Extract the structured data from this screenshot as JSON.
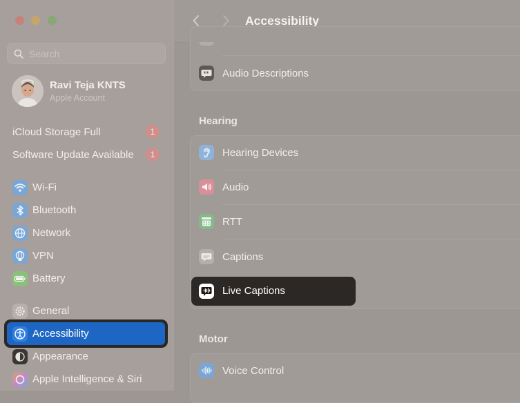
{
  "sidebar": {
    "search_placeholder": "Search",
    "profile": {
      "name": "Ravi Teja KNTS",
      "subtitle": "Apple Account"
    },
    "notices": [
      {
        "label": "iCloud Storage Full",
        "badge": "1"
      },
      {
        "label": "Software Update Available",
        "badge": "1"
      }
    ],
    "items": [
      {
        "label": "Wi-Fi",
        "icon": "wifi-icon",
        "color": "#7aa6d6"
      },
      {
        "label": "Bluetooth",
        "icon": "bluetooth-icon",
        "color": "#7aa6d6"
      },
      {
        "label": "Network",
        "icon": "globe-icon",
        "color": "#7aa6d6"
      },
      {
        "label": "VPN",
        "icon": "vpn-globe-icon",
        "color": "#7aa6d6"
      },
      {
        "label": "Battery",
        "icon": "battery-icon",
        "color": "#8bbf7c"
      },
      {
        "label": "General",
        "icon": "gear-icon",
        "color": "#b7b1ad"
      },
      {
        "label": "Accessibility",
        "icon": "accessibility-icon",
        "color": "#2f7ee0",
        "selected": true
      },
      {
        "label": "Appearance",
        "icon": "appearance-icon",
        "color": "#3a3634"
      },
      {
        "label": "Apple Intelligence & Siri",
        "icon": "siri-icon",
        "color": "#c9a6c7"
      }
    ]
  },
  "toolbar": {
    "title": "Accessibility"
  },
  "content": {
    "top_row": {
      "label": "Audio Descriptions",
      "icon": "audio-descriptions-icon"
    },
    "hearing": {
      "header": "Hearing",
      "rows": [
        {
          "label": "Hearing Devices",
          "icon": "ear-icon",
          "color": "#8fb3d8"
        },
        {
          "label": "Audio",
          "icon": "speaker-icon",
          "color": "#d98f98"
        },
        {
          "label": "RTT",
          "icon": "rtt-phone-icon",
          "color": "#86b98a"
        },
        {
          "label": "Captions",
          "icon": "captions-icon",
          "color": "#b4afab"
        },
        {
          "label": "Live Captions",
          "icon": "live-captions-icon",
          "color": "#ffffff"
        }
      ]
    },
    "motor": {
      "header": "Motor",
      "rows": [
        {
          "label": "Voice Control",
          "icon": "voice-control-icon",
          "color": "#7aa6d6"
        }
      ]
    }
  }
}
